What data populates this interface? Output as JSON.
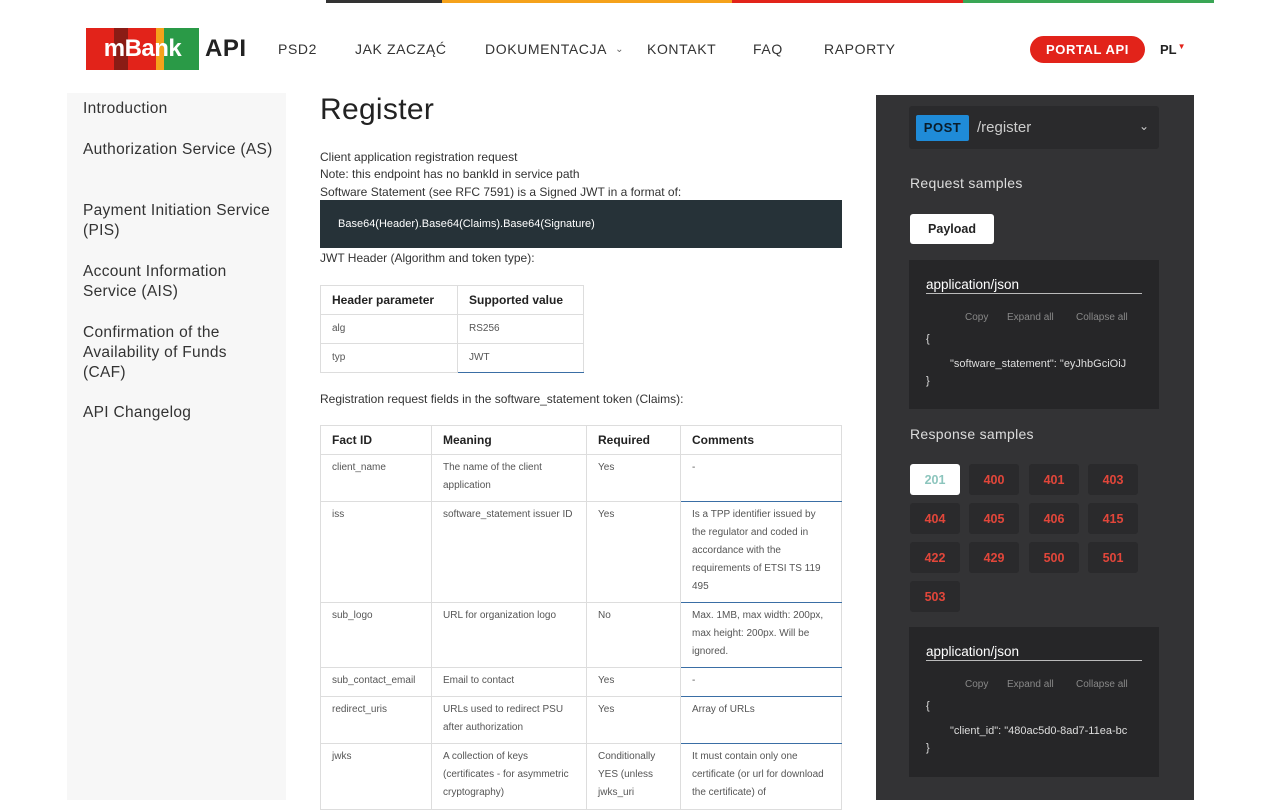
{
  "colors": {
    "stripe": [
      "#333333",
      "#f5a21b",
      "#e2231a",
      "#3aa655"
    ],
    "logo_stripes": [
      "#e2231a",
      "#2a9a47",
      "#f5a21b",
      "#8a1c15"
    ],
    "brand_red": "#e2231a",
    "post_badge": "#1f8bd8",
    "panel_bg": "#333335"
  },
  "header": {
    "logo_text": "mBank",
    "logo_api": "API",
    "nav": [
      "PSD2",
      "JAK ZACZĄĆ",
      "DOKUMENTACJA",
      "KONTAKT",
      "FAQ",
      "RAPORTY"
    ],
    "portal_button": "PORTAL API",
    "language": "PL"
  },
  "sidebar": {
    "items": [
      "Introduction",
      "Authorization Service (AS)",
      "Payment Initiation Service (PIS)",
      "Account Information Service (AIS)",
      "Confirmation of the Availability of Funds (CAF)",
      "API Changelog"
    ]
  },
  "main": {
    "title": "Register",
    "desc": [
      "Client application registration request",
      "Note: this endpoint has no bankId in service path",
      "Software Statement (see RFC 7591) is a Signed JWT in a format of:"
    ],
    "code": "Base64(Header).Base64(Claims).Base64(Signature)",
    "jwt_header_label": "JWT Header (Algorithm and token type):",
    "header_table": {
      "columns": [
        "Header parameter",
        "Supported value"
      ],
      "rows": [
        [
          "alg",
          "RS256"
        ],
        [
          "typ",
          "JWT"
        ]
      ]
    },
    "claims_label": "Registration request fields in the software_statement token (Claims):",
    "claims_table": {
      "columns": [
        "Fact ID",
        "Meaning",
        "Required",
        "Comments"
      ],
      "rows": [
        [
          "client_name",
          "The name of the client application",
          "Yes",
          "-"
        ],
        [
          "iss",
          "software_statement issuer ID",
          "Yes",
          "Is a TPP identifier issued by the regulator and coded in accordance with the requirements of ETSI TS 119 495"
        ],
        [
          "sub_logo",
          "URL for organization logo",
          "No",
          "Max. 1MB, max width: 200px, max height: 200px. Will be ignored."
        ],
        [
          "sub_contact_email",
          "Email to contact",
          "Yes",
          "-"
        ],
        [
          "redirect_uris",
          "URLs used to redirect PSU after authorization",
          "Yes",
          "Array of URLs"
        ],
        [
          "jwks",
          "A collection of keys (certificates - for asymmetric cryptography)",
          "Conditionally YES (unless jwks_uri",
          "It must contain only one certificate (or url for download the certificate) of"
        ]
      ]
    }
  },
  "panel": {
    "method": "POST",
    "path": "/register",
    "request_samples": "Request samples",
    "payload_button": "Payload",
    "request_json": {
      "content_type": "application/json",
      "actions": [
        "Copy",
        "Expand all",
        "Collapse all"
      ],
      "open": "{",
      "line": "\"software_statement\": \"eyJhbGciOiJ",
      "close": "}"
    },
    "response_samples": "Response samples",
    "codes": [
      "201",
      "400",
      "401",
      "403",
      "404",
      "405",
      "406",
      "415",
      "422",
      "429",
      "500",
      "501",
      "503"
    ],
    "response_json": {
      "content_type": "application/json",
      "actions": [
        "Copy",
        "Expand all",
        "Collapse all"
      ],
      "open": "{",
      "line": "\"client_id\": \"480ac5d0-8ad7-11ea-bc",
      "close": "}"
    }
  }
}
